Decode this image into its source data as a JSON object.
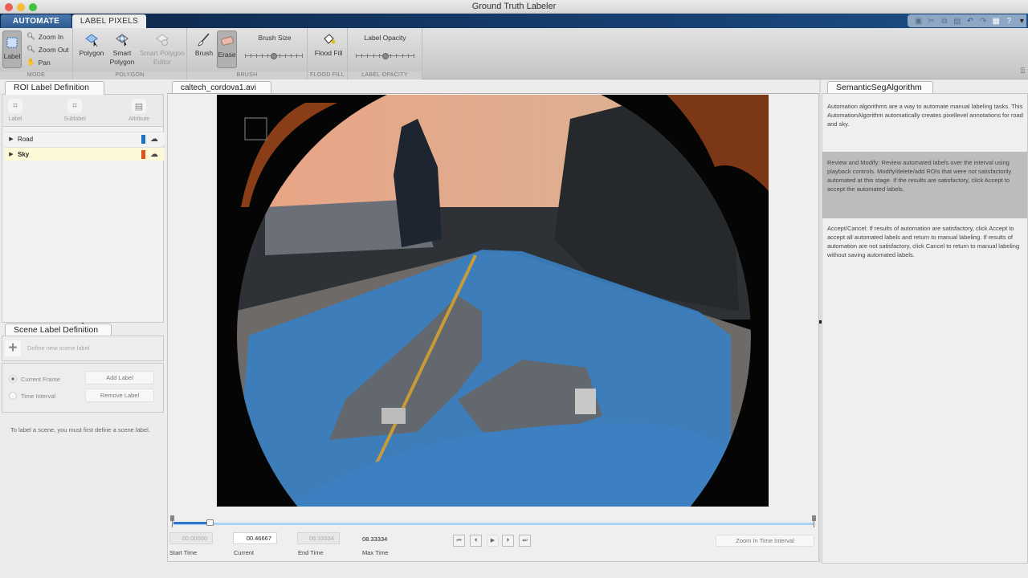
{
  "window": {
    "title": "Ground Truth Labeler"
  },
  "ribbon_tabs": [
    {
      "label": "AUTOMATE",
      "active": false
    },
    {
      "label": "LABEL PIXELS",
      "active": true
    }
  ],
  "quick_access": [
    "save-icon",
    "cut-icon",
    "copy-icon",
    "paste-icon",
    "undo-icon",
    "redo-icon",
    "layout-icon",
    "help-icon",
    "dropdown-icon"
  ],
  "ribbon": {
    "mode": {
      "section_label": "MODE",
      "label_btn": "Label",
      "zoom_in": "Zoom In",
      "zoom_out": "Zoom Out",
      "pan": "Pan"
    },
    "polygon": {
      "section_label": "POLYGON",
      "polygon": "Polygon",
      "smart_polygon_1": "Smart",
      "smart_polygon_2": "Polygon",
      "editor_1": "Smart Polygon",
      "editor_2": "Editor"
    },
    "brush": {
      "section_label": "BRUSH",
      "brush": "Brush",
      "erase": "Erase",
      "brush_size_label": "Brush Size",
      "brush_size_value": 0.5
    },
    "flood_fill": {
      "section_label": "FLOOD FILL",
      "label": "Flood Fill"
    },
    "label_opacity": {
      "section_label": "LABEL OPACITY",
      "label": "Label Opacity",
      "value": 0.5
    }
  },
  "roi_panel": {
    "tab": "ROI Label Definition",
    "buttons": {
      "label": "Label",
      "sublabel": "Sublabel",
      "attribute": "Attribute"
    },
    "labels": [
      {
        "name": "Road",
        "color": "#1f6fc2",
        "selected": false
      },
      {
        "name": "Sky",
        "color": "#e0501f",
        "selected": true
      }
    ]
  },
  "scene_panel": {
    "tab": "Scene Label Definition",
    "define_text": "Define new scene label",
    "current_frame": "Current Frame",
    "time_interval": "Time Interval",
    "add_label": "Add Label",
    "remove_label": "Remove Label",
    "note": "To label a scene, you must first define a scene label."
  },
  "video": {
    "tab": "caltech_cordova1.avi",
    "colors": {
      "sky": "#e9a384",
      "road": "#3a7fc0"
    }
  },
  "timeline": {
    "progress": 0.056,
    "start_time": "00.00000",
    "start_label": "Start Time",
    "current_time": "00.46667",
    "current_label": "Current",
    "end_time": "08.33334",
    "end_label": "End Time",
    "max_time": "08.33334",
    "max_label": "Max Time",
    "zoom_interval": "Zoom In Time Interval"
  },
  "playback": [
    "first-frame-icon",
    "prev-frame-icon",
    "play-icon",
    "next-frame-icon",
    "last-frame-icon"
  ],
  "algorithm_panel": {
    "tab": "SemanticSegAlgorithm",
    "description": "Automation algorithms are a way to automate manual labeling tasks. This AutomationAlgorithm automatically creates pixellevel annotations for road and sky.",
    "review": "Review and Modify: Review automated labels over the interval using playback controls. Modify/delete/add ROIs that were not satisfactorily automated at this stage. If the results are satisfactory, click Accept to accept the automated labels.",
    "accept_cancel": "Accept/Cancel: If results of automation are satisfactory, click Accept to accept all automated labels and return to manual labeling. If results of automation are not satisfactory, click Cancel to return to manual labeling without saving automated labels."
  }
}
